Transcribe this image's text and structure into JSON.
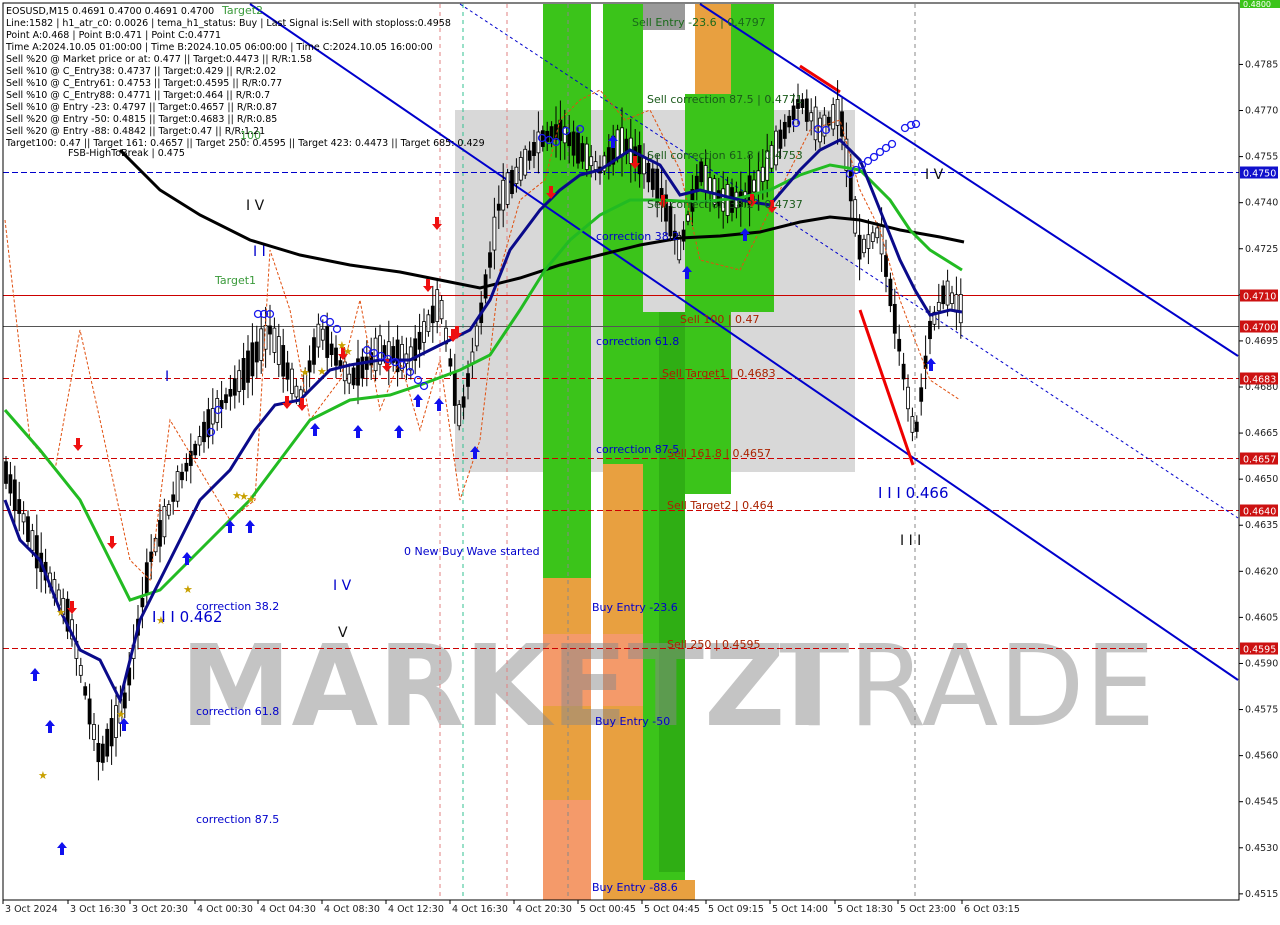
{
  "header": {
    "lines": [
      "EOSUSD,M15  0.4691 0.4700 0.4691 0.4700",
      "Line:1582 | h1_atr_c0: 0.0026 | tema_h1_status: Buy | Last Signal is:Sell with stoploss:0.4958",
      "Point A:0.468 | Point B:0.471 | Point C:0.4771",
      "Time A:2024.10.05 01:00:00 | Time B:2024.10.05 06:00:00 | Time C:2024.10.05 16:00:00",
      "Sell %20 @ Market price or at: 0.477 || Target:0.4473 || R/R:1.58",
      "Sell %10 @ C_Entry38: 0.4737 || Target:0.429 || R/R:2.02",
      "Sell %10 @ C_Entry61: 0.4753 || Target:0.4595 || R/R:0.77",
      "Sell %10 @ C_Entry88: 0.4771 || Target:0.464 || R/R:0.7",
      "Sell %10 @ Entry -23: 0.4797 || Target:0.4657 || R/R:0.87",
      "Sell %20 @ Entry -50: 0.4815 || Target:0.4683 || R/R:0.85",
      "Sell %20 @ Entry -88: 0.4842 || Target:0.47 || R/R:1.21",
      "Target100: 0.47 || Target 161: 0.4657 || Target 250: 0.4595 || Target 423: 0.4473 || Target 685: 0.429"
    ],
    "fsb": "FSB-HighToBreak | 0.475"
  },
  "watermark": {
    "part1": "MARKETZI",
    "part2": "TRADE"
  },
  "colors": {
    "background": "#ffffff",
    "green_zone": "#3bc41a",
    "orange_zone": "#e8a040",
    "salmon_zone": "#f49a6a",
    "gray_zone": "#d8d8d8",
    "channel": "#0000cc",
    "hline": "#cc0000",
    "ma_black": "#000000",
    "ma_green": "#22bb22",
    "ma_navy": "#0a0a8a",
    "price_tag_red": "#cc1111",
    "price_tag_blue": "#1010cc"
  },
  "chart_data": {
    "type": "candlestick",
    "symbol": "EOSUSD",
    "timeframe": "M15",
    "ylim": [
      0.4513,
      0.4805
    ],
    "y_ticks": [
      "0.4785",
      "0.4770",
      "0.4755",
      "0.4740",
      "0.4725",
      "0.4710",
      "0.4695",
      "0.4680",
      "0.4665",
      "0.4650",
      "0.4635",
      "0.4620",
      "0.4605",
      "0.4590",
      "0.4575",
      "0.4560",
      "0.4545",
      "0.4530",
      "0.4515"
    ],
    "x_labels": [
      "3 Oct 2024",
      "3 Oct 16:30",
      "3 Oct 20:30",
      "4 Oct 00:30",
      "4 Oct 04:30",
      "4 Oct 08:30",
      "4 Oct 12:30",
      "4 Oct 16:30",
      "4 Oct 20:30",
      "5 Oct 00:45",
      "5 Oct 04:45",
      "5 Oct 09:15",
      "5 Oct 14:00",
      "5 Oct 18:30",
      "5 Oct 23:00",
      "6 Oct 03:15"
    ],
    "horizontal_levels": [
      {
        "value": 0.475,
        "label": "0.4750",
        "style": "dashed",
        "color": "#0000cc"
      },
      {
        "value": 0.471,
        "label": "0.4710",
        "style": "solid",
        "color": "#cc0000"
      },
      {
        "value": 0.47,
        "label": "0.4700",
        "style": "solid",
        "color": "#555555"
      },
      {
        "value": 0.4683,
        "label": "0.4683",
        "style": "dashed",
        "color": "#cc0000"
      },
      {
        "value": 0.4657,
        "label": "0.4657",
        "style": "dashed",
        "color": "#cc0000"
      },
      {
        "value": 0.464,
        "label": "0.4640",
        "style": "dashed",
        "color": "#cc0000"
      },
      {
        "value": 0.4595,
        "label": "0.4595",
        "style": "dashed",
        "color": "#cc0000"
      }
    ],
    "top_tag": "0.4800",
    "level_labels": [
      {
        "text": "Sell Entry -23.6 | 0.4797",
        "color": "#1a6a1a"
      },
      {
        "text": "Sell correction 87.5 | 0.4771",
        "color": "#1a6a1a"
      },
      {
        "text": "Sell correction 61.8 | 0.4753",
        "color": "#1a6a1a"
      },
      {
        "text": "Sell correction 38.2 | 0.4737",
        "color": "#1a6a1a"
      },
      {
        "text": "Sell 100 | 0.47",
        "color": "#aa2200"
      },
      {
        "text": "Sell Target1 | 0.4683",
        "color": "#aa2200"
      },
      {
        "text": "Sell 161.8 | 0.4657",
        "color": "#aa2200"
      },
      {
        "text": "Sell Target2 | 0.464",
        "color": "#aa2200"
      },
      {
        "text": "Sell  250 | 0.4595",
        "color": "#aa2200"
      },
      {
        "text": "correction 38.2",
        "color": "#0000cc"
      },
      {
        "text": "correction 61.8",
        "color": "#0000cc"
      },
      {
        "text": "correction 87.5",
        "color": "#0000cc"
      },
      {
        "text": "Buy Entry -23.6",
        "color": "#0000cc"
      },
      {
        "text": "Buy Entry -50",
        "color": "#0000cc"
      },
      {
        "text": "Buy Entry -88.6",
        "color": "#0000cc"
      },
      {
        "text": "correction 38.2",
        "color": "#0000cc"
      },
      {
        "text": "correction 61.8",
        "color": "#0000cc"
      },
      {
        "text": "correction 87.5",
        "color": "#0000cc"
      },
      {
        "text": "0 New Buy Wave started",
        "color": "#0000cc"
      },
      {
        "text": "I I I 0.462",
        "color": "#0000cc"
      },
      {
        "text": "I I I 0.466",
        "color": "#0000cc"
      },
      {
        "text": "Target1",
        "color": "#3a9a3a"
      },
      {
        "text": "Target2",
        "color": "#3a9a3a"
      },
      {
        "text": "100",
        "color": "#3a9a3a"
      }
    ],
    "wave_labels": [
      "I V",
      "I I",
      "I",
      "I V",
      "V",
      "I V",
      "I I I"
    ]
  }
}
